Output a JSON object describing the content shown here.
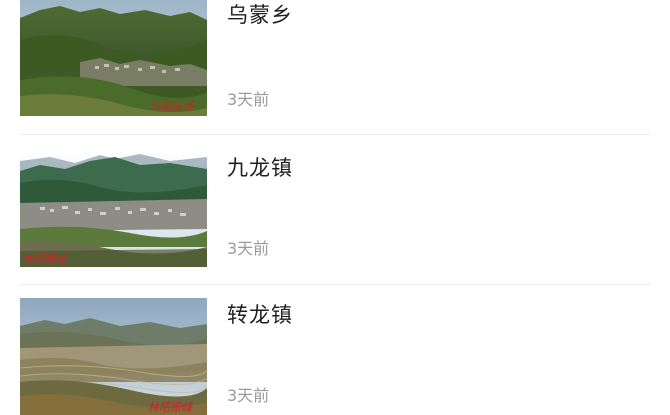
{
  "colors": {
    "title_text": "#1f1f1f",
    "time_text": "#9b9b9b",
    "divider": "#ececec",
    "watermark": "#c8262c"
  },
  "feed": {
    "items": [
      {
        "title": "乌蒙乡",
        "time": "3天前",
        "image": "mountain-village-landscape",
        "watermark": "林昭振峰"
      },
      {
        "title": "九龙镇",
        "time": "3天前",
        "image": "valley-town-landscape",
        "watermark": "林昭振峰"
      },
      {
        "title": "转龙镇",
        "time": "3天前",
        "image": "highland-terraces-landscape",
        "watermark": "林昭振峰"
      }
    ]
  }
}
